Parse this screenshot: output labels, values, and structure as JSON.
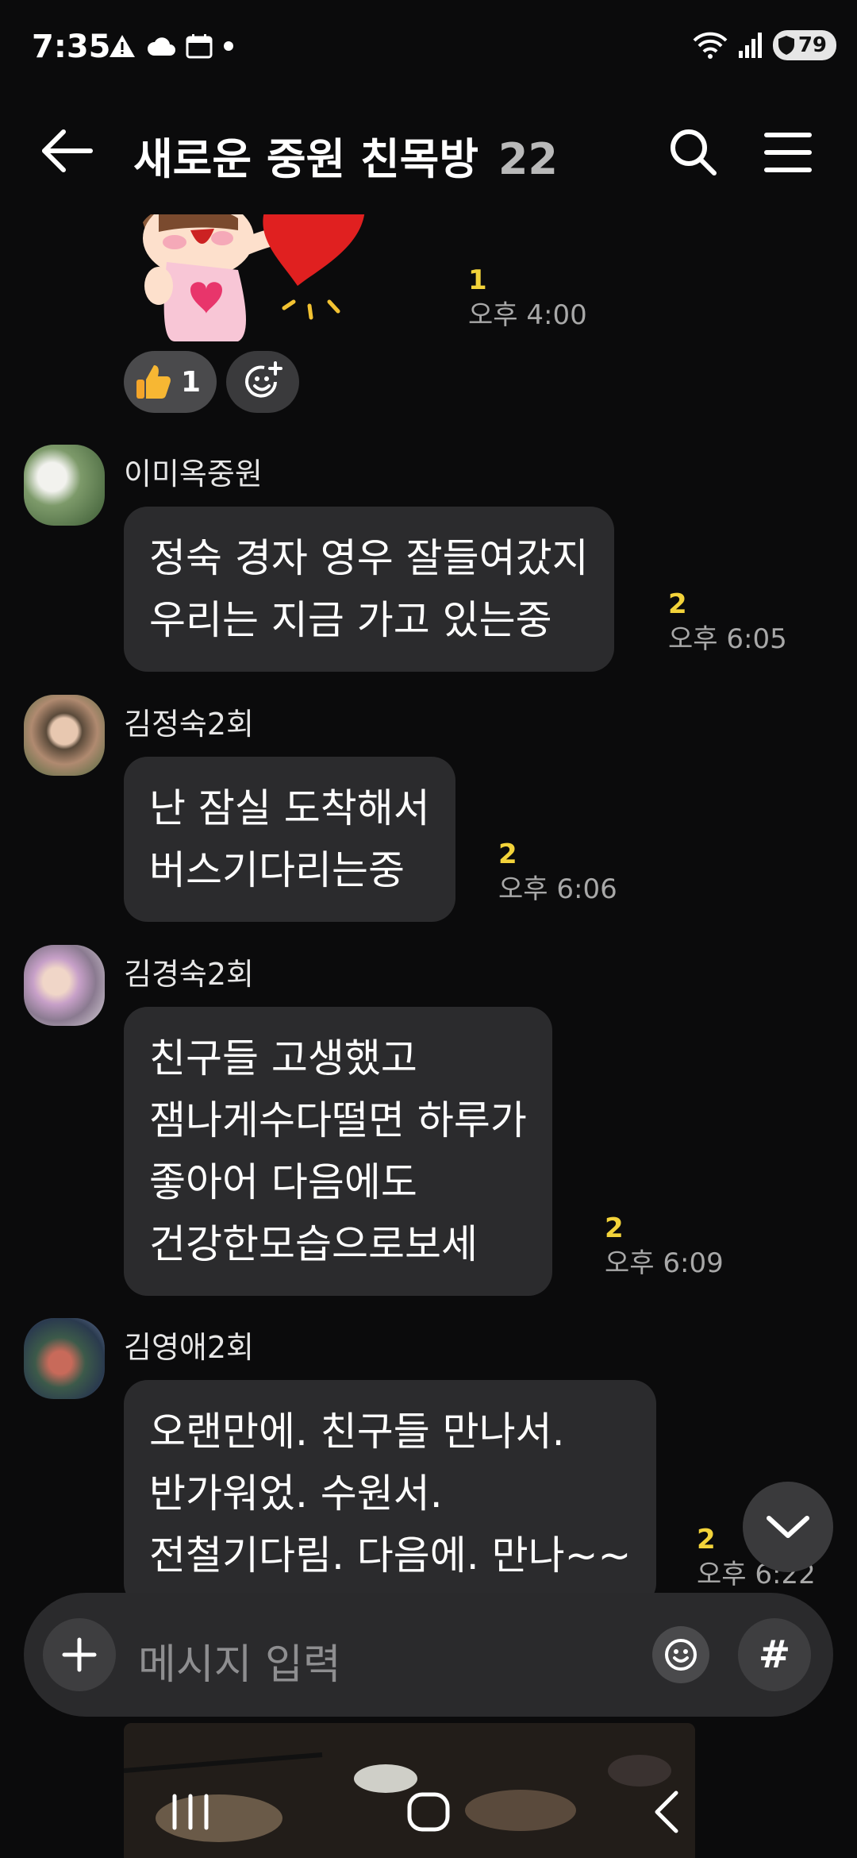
{
  "status_bar": {
    "time": "7:35",
    "battery": "79"
  },
  "header": {
    "title": "새로운 중원 친목방",
    "member_count": "22"
  },
  "sticker_message": {
    "unread": "1",
    "time": "오후 4:00",
    "reaction_count": "1"
  },
  "messages": [
    {
      "sender": "이미옥중원",
      "lines": [
        "정숙 경자 영우 잘들여갔지",
        "우리는 지금 가고 있는중"
      ],
      "unread": "2",
      "time": "오후 6:05"
    },
    {
      "sender": "김정숙2회",
      "lines": [
        "난 잠실 도착해서",
        "버스기다리는중"
      ],
      "unread": "2",
      "time": "오후 6:06"
    },
    {
      "sender": "김경숙2회",
      "lines": [
        "친구들 고생했고",
        "잼나게수다떨면 하루가",
        "좋아어 다음에도",
        "건강한모습으로보세"
      ],
      "unread": "2",
      "time": "오후 6:09"
    },
    {
      "sender": "김영애2회",
      "lines": [
        "오랜만에. 친구들 만나서.",
        "반가워었. 수원서.",
        "전철기다림.  다음에. 만나~~"
      ],
      "unread": "2",
      "time": "오후 6:22"
    }
  ],
  "input": {
    "placeholder": "메시지 입력",
    "hash_label": "#"
  },
  "colors": {
    "background": "#0b0b0c",
    "bubble": "#2b2b2d",
    "unread": "#f3d33a",
    "timestamp": "#a8a8a8"
  },
  "icons": [
    "back-arrow-icon",
    "search-icon",
    "menu-icon",
    "thumbs-up-icon",
    "add-reaction-icon",
    "chevron-down-icon",
    "plus-icon",
    "emoji-icon",
    "hash-icon"
  ]
}
